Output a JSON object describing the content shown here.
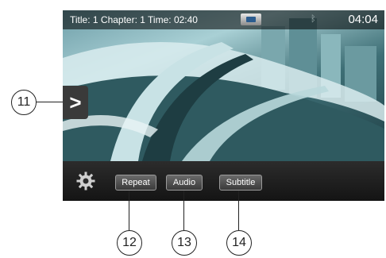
{
  "status_bar": {
    "info_text": "Title: 1 Chapter: 1 Time: 02:40",
    "clock": "04:04",
    "icons": [
      "disc-icon",
      "bluetooth-icon"
    ]
  },
  "side_panel": {
    "arrow_glyph": ">"
  },
  "toolbar": {
    "settings_icon": "gear-icon",
    "repeat_label": "Repeat",
    "audio_label": "Audio",
    "subtitle_label": "Subtitle"
  },
  "callouts": {
    "c11": "11",
    "c12": "12",
    "c13": "13",
    "c14": "14"
  }
}
